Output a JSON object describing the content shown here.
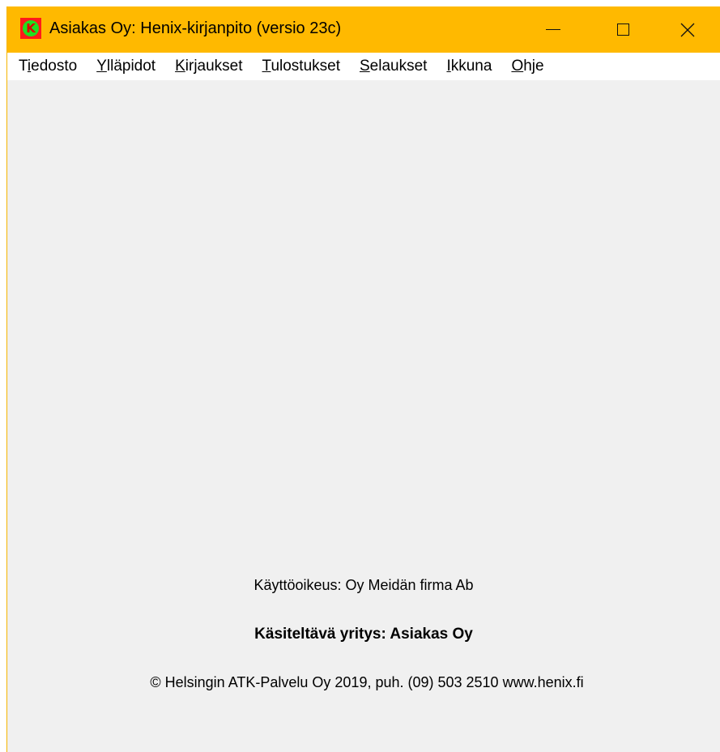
{
  "window": {
    "title": "Asiakas Oy: Henix-kirjanpito (versio 23c)",
    "icon_letter": "K",
    "controls": {
      "minimize": "minimize-icon",
      "maximize": "maximize-icon",
      "close": "close-icon"
    },
    "accent_color": "#ffb900"
  },
  "menu": {
    "items": [
      {
        "pre": "T",
        "acc": "i",
        "post": "edosto"
      },
      {
        "pre": "",
        "acc": "Y",
        "post": "lläpidot"
      },
      {
        "pre": "",
        "acc": "K",
        "post": "irjaukset"
      },
      {
        "pre": "",
        "acc": "T",
        "post": "ulostukset"
      },
      {
        "pre": "",
        "acc": "S",
        "post": "elaukset"
      },
      {
        "pre": "",
        "acc": "I",
        "post": "kkuna"
      },
      {
        "pre": "",
        "acc": "O",
        "post": "hje"
      }
    ]
  },
  "footer": {
    "license": "Käyttöoikeus: Oy Meidän firma Ab",
    "company": "Käsiteltävä yritys: Asiakas Oy",
    "copyright": "© Helsingin ATK-Palvelu Oy 2019, puh. (09) 503 2510 www.henix.fi"
  }
}
